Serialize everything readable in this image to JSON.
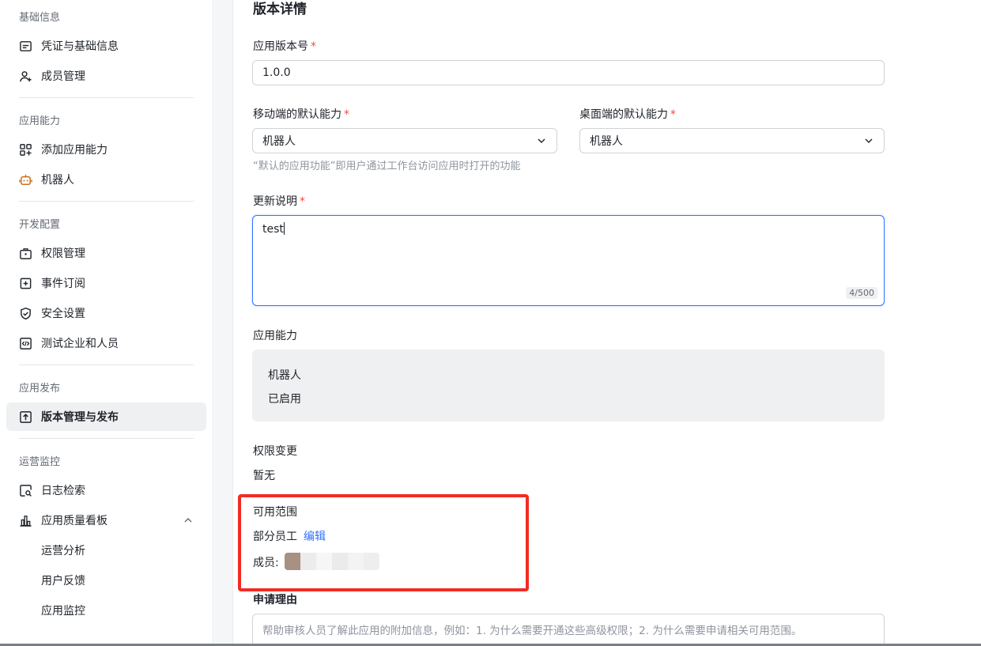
{
  "sidebar": {
    "groups": [
      {
        "title": "基础信息",
        "items": [
          "凭证与基础信息",
          "成员管理"
        ]
      },
      {
        "title": "应用能力",
        "items": [
          "添加应用能力",
          "机器人"
        ]
      },
      {
        "title": "开发配置",
        "items": [
          "权限管理",
          "事件订阅",
          "安全设置",
          "测试企业和人员"
        ]
      },
      {
        "title": "应用发布",
        "items": [
          "版本管理与发布"
        ]
      },
      {
        "title": "运营监控",
        "items": [
          "日志检索",
          "应用质量看板",
          "运营分析",
          "用户反馈",
          "应用监控"
        ]
      }
    ],
    "active_item": "版本管理与发布"
  },
  "form": {
    "section_title": "版本详情",
    "version_label": "应用版本号",
    "version_value": "1.0.0",
    "mobile_label": "移动端的默认能力",
    "mobile_value": "机器人",
    "desktop_label": "桌面端的默认能力",
    "desktop_value": "机器人",
    "default_hint": "“默认的应用功能”即用户通过工作台访问应用时打开的功能",
    "notes_label": "更新说明",
    "notes_value": "test",
    "notes_counter": "4/500",
    "capability_label": "应用能力",
    "capability_name": "机器人",
    "capability_status": "已启用",
    "permission_label": "权限变更",
    "permission_value": "暂无",
    "scope_label": "可用范围",
    "scope_value": "部分员工",
    "scope_edit": "编辑",
    "members_label": "成员:",
    "reason_label": "申请理由",
    "reason_placeholder": "帮助审核人员了解此应用的附加信息，例如：1. 为什么需要开通这些高级权限；2. 为什么需要申请相关可用范围。",
    "required_mark": "*"
  },
  "colors": {
    "accent": "#3370ff",
    "required": "#f54a45",
    "highlight": "#f22b24",
    "active_bg": "#eff0f1"
  }
}
